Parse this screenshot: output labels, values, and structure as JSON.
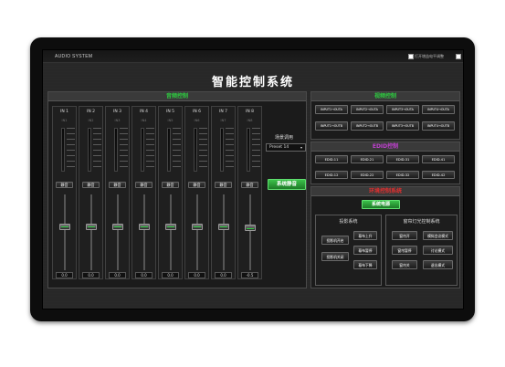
{
  "topbar": {
    "brand": "AUDIO SYSTEM",
    "checkbox_label": "打开增益电平调整"
  },
  "title": "智能控制系统",
  "audio": {
    "title": "音频控制",
    "title_color": "#2ecc40",
    "channels": [
      {
        "label": "IN 1",
        "sub": "IN1",
        "mute": "静音",
        "fader_level": 0.62,
        "value": "0.0"
      },
      {
        "label": "IN 2",
        "sub": "IN2",
        "mute": "静音",
        "fader_level": 0.62,
        "value": "0.0"
      },
      {
        "label": "IN 3",
        "sub": "IN3",
        "mute": "静音",
        "fader_level": 0.62,
        "value": "0.0"
      },
      {
        "label": "IN 4",
        "sub": "IN4",
        "mute": "静音",
        "fader_level": 0.62,
        "value": "0.0"
      },
      {
        "label": "IN 5",
        "sub": "IN5",
        "mute": "静音",
        "fader_level": 0.62,
        "value": "0.0"
      },
      {
        "label": "IN 6",
        "sub": "IN6",
        "mute": "静音",
        "fader_level": 0.62,
        "value": "0.0"
      },
      {
        "label": "IN 7",
        "sub": "IN7",
        "mute": "静音",
        "fader_level": 0.62,
        "value": "0.0"
      },
      {
        "label": "IN 8",
        "sub": "IN8",
        "mute": "静音",
        "fader_level": 0.6,
        "value": "-0.5"
      }
    ],
    "scene_label": "场景调用",
    "preset_value": "Preset 14",
    "system_mute": "系统静音"
  },
  "video": {
    "title": "视频控制",
    "title_color": "#2ecc40",
    "buttons": [
      "INPUT1→OUTA",
      "INPUT2→OUTA",
      "INPUT3→OUTA",
      "INPUT4→OUTA",
      "INPUT1→OUTB",
      "INPUT2→OUTB",
      "INPUT3→OUTB",
      "INPUT4→OUTB"
    ]
  },
  "edid": {
    "title": "EDID控制",
    "title_color": "#c040d0",
    "buttons": [
      "EDID-11",
      "EDID-21",
      "EDID-31",
      "EDID-41",
      "EDID-12",
      "EDID-22",
      "EDID-32",
      "EDID-42"
    ]
  },
  "env": {
    "title": "环境控制系统",
    "title_color": "#e03030",
    "power": "系统电源",
    "projection": {
      "title": "投影系统",
      "buttons": [
        "投影机开启",
        "投影机关闭",
        "幕布上升",
        "幕布暂停",
        "幕布下降"
      ]
    },
    "lighting": {
      "title": "窗帘灯光控制系统",
      "buttons": [
        "窗帘开",
        "窗帘暂停",
        "窗帘关",
        "模拟会议模式",
        "讨论模式",
        "退出模式"
      ]
    }
  }
}
